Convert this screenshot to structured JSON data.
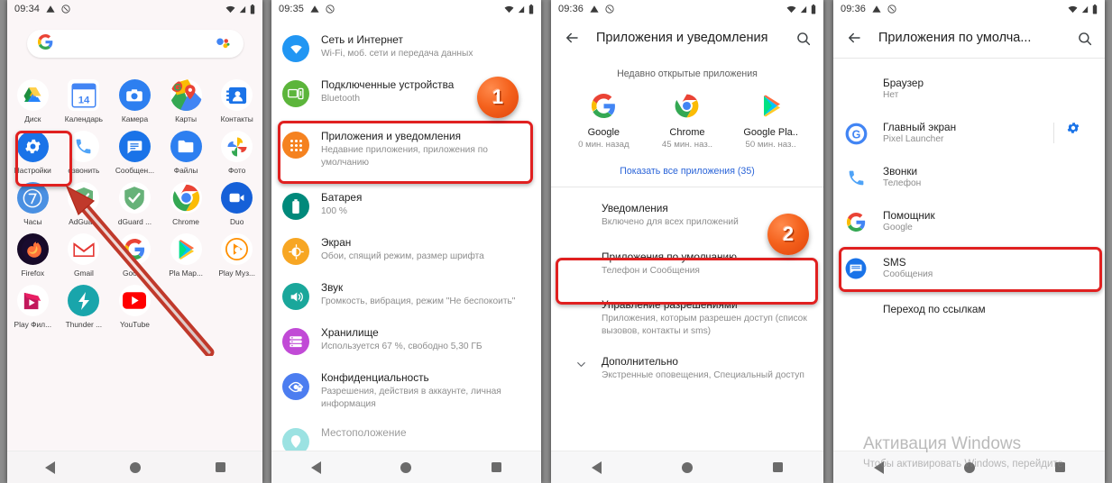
{
  "panels": {
    "launcher": {
      "status": {
        "time": "09:34",
        "icons": [
          "warning-icon",
          "dnd-icon"
        ],
        "right": [
          "wifi-icon",
          "signal-icon",
          "battery-icon"
        ]
      },
      "search": {
        "logo": "google-logo",
        "mic": "assistant-mic-icon",
        "placeholder": ""
      },
      "apps": [
        {
          "label": "Диск",
          "icon": "google-drive-icon"
        },
        {
          "label": "Календарь",
          "icon": "google-calendar-icon",
          "day": "14"
        },
        {
          "label": "Камера",
          "icon": "camera-icon"
        },
        {
          "label": "Карты",
          "icon": "google-maps-icon"
        },
        {
          "label": "Контакты",
          "icon": "contacts-icon"
        },
        {
          "label": "Настройки",
          "icon": "settings-gear-icon"
        },
        {
          "label": "озвонить",
          "icon": "phone-icon"
        },
        {
          "label": "Сообщен...",
          "icon": "messages-icon"
        },
        {
          "label": "Файлы",
          "icon": "files-icon"
        },
        {
          "label": "Фото",
          "icon": "google-photos-icon"
        },
        {
          "label": "Часы",
          "icon": "clock-icon"
        },
        {
          "label": "AdGuard",
          "icon": "adguard-icon"
        },
        {
          "label": "dGuard ...",
          "icon": "adguard-vpn-icon"
        },
        {
          "label": "Chrome",
          "icon": "chrome-icon"
        },
        {
          "label": "Duo",
          "icon": "google-duo-icon"
        },
        {
          "label": "Firefox",
          "icon": "firefox-icon"
        },
        {
          "label": "Gmail",
          "icon": "gmail-icon"
        },
        {
          "label": "Google",
          "icon": "google-app-icon"
        },
        {
          "label": "Pla Map...",
          "icon": "play-store-icon"
        },
        {
          "label": "Play Муз...",
          "icon": "play-music-icon"
        },
        {
          "label": "Play Фил...",
          "icon": "play-movies-icon"
        },
        {
          "label": "Thunder ...",
          "icon": "thunder-vpn-icon"
        },
        {
          "label": "YouTube",
          "icon": "youtube-icon"
        }
      ],
      "nav": {
        "back": "back-triangle-icon",
        "home": "home-circle-icon",
        "recents": "recents-square-icon"
      }
    },
    "settings": {
      "status": {
        "time": "09:35"
      },
      "items": [
        {
          "title": "Сеть и Интернет",
          "sub": "Wi-Fi, моб. сети и передача данных",
          "icon": "wifi-icon",
          "color": "#2196f3"
        },
        {
          "title": "Подключенные устройства",
          "sub": "Bluetooth",
          "icon": "devices-icon",
          "color": "#5cb53b"
        },
        {
          "title": "Приложения и уведомления",
          "sub": "Недавние приложения, приложения по умолчанию",
          "icon": "apps-grid-icon",
          "color": "#f58220"
        },
        {
          "title": "Батарея",
          "sub": "100 %",
          "icon": "battery-icon",
          "color": "#00897b"
        },
        {
          "title": "Экран",
          "sub": "Обои, спящий режим, размер шрифта",
          "icon": "display-icon",
          "color": "#f7a623"
        },
        {
          "title": "Звук",
          "sub": "Громкость, вибрация, режим \"Не беспокоить\"",
          "icon": "sound-icon",
          "color": "#1aa79b"
        },
        {
          "title": "Хранилище",
          "sub": "Используется 67 %, свободно 5,30 ГБ",
          "icon": "storage-icon",
          "color": "#c14ad6"
        },
        {
          "title": "Конфиденциальность",
          "sub": "Разрешения, действия в аккаунте, личная информация",
          "icon": "privacy-icon",
          "color": "#4c7df0"
        },
        {
          "title": "Местоположение",
          "sub": "",
          "icon": "location-icon",
          "color": "#23c1c1"
        }
      ]
    },
    "apps_and_notifications": {
      "status": {
        "time": "09:36"
      },
      "toolbar": {
        "back": "arrow-back-icon",
        "title": "Приложения и уведомления",
        "search": "search-icon"
      },
      "recent_label": "Недавно открытые приложения",
      "recents": [
        {
          "name": "Google",
          "time": "0 мин. назад",
          "icon": "google-app-icon"
        },
        {
          "name": "Chrome",
          "time": "45 мин. наз..",
          "icon": "chrome-icon"
        },
        {
          "name": "Google Pla..",
          "time": "50 мин. наз..",
          "icon": "play-store-icon"
        }
      ],
      "show_all": "Показать все приложения (35)",
      "items": [
        {
          "title": "Уведомления",
          "sub": "Включено для всех приложений"
        },
        {
          "title": "Приложения по умолчанию",
          "sub": "Телефон и Сообщения"
        },
        {
          "title": "Управление разрешениями",
          "sub": "Приложения, которым разрешен доступ (список вызовов, контакты и sms)"
        },
        {
          "title": "Дополнительно",
          "sub": "Экстренные оповещения, Специальный доступ",
          "chevron": "chevron-down-icon"
        }
      ]
    },
    "default_apps": {
      "status": {
        "time": "09:36"
      },
      "toolbar": {
        "back": "arrow-back-icon",
        "title": "Приложения по умолча...",
        "search": "search-icon"
      },
      "items": [
        {
          "title": "Браузер",
          "sub": "Нет",
          "icon": "none-icon",
          "gear": false
        },
        {
          "title": "Главный экран",
          "sub": "Pixel Launcher",
          "icon": "pixel-launcher-icon",
          "gear": true,
          "gear_icon": "gear-icon"
        },
        {
          "title": "Звонки",
          "sub": "Телефон",
          "icon": "phone-icon",
          "gear": false
        },
        {
          "title": "Помощник",
          "sub": "Google",
          "icon": "google-app-icon",
          "gear": false
        },
        {
          "title": "SMS",
          "sub": "Сообщения",
          "icon": "messages-icon",
          "gear": false
        },
        {
          "title": "Переход по ссылкам",
          "sub": "",
          "icon": "none-icon",
          "gear": false
        }
      ]
    }
  },
  "annotations": {
    "badges": [
      {
        "label": "1"
      },
      {
        "label": "2"
      }
    ],
    "arrow": "red-arrow-pointer"
  },
  "watermark": {
    "title": "Активация Windows",
    "subtitle": "Чтобы активировать Windows, перейдите"
  }
}
